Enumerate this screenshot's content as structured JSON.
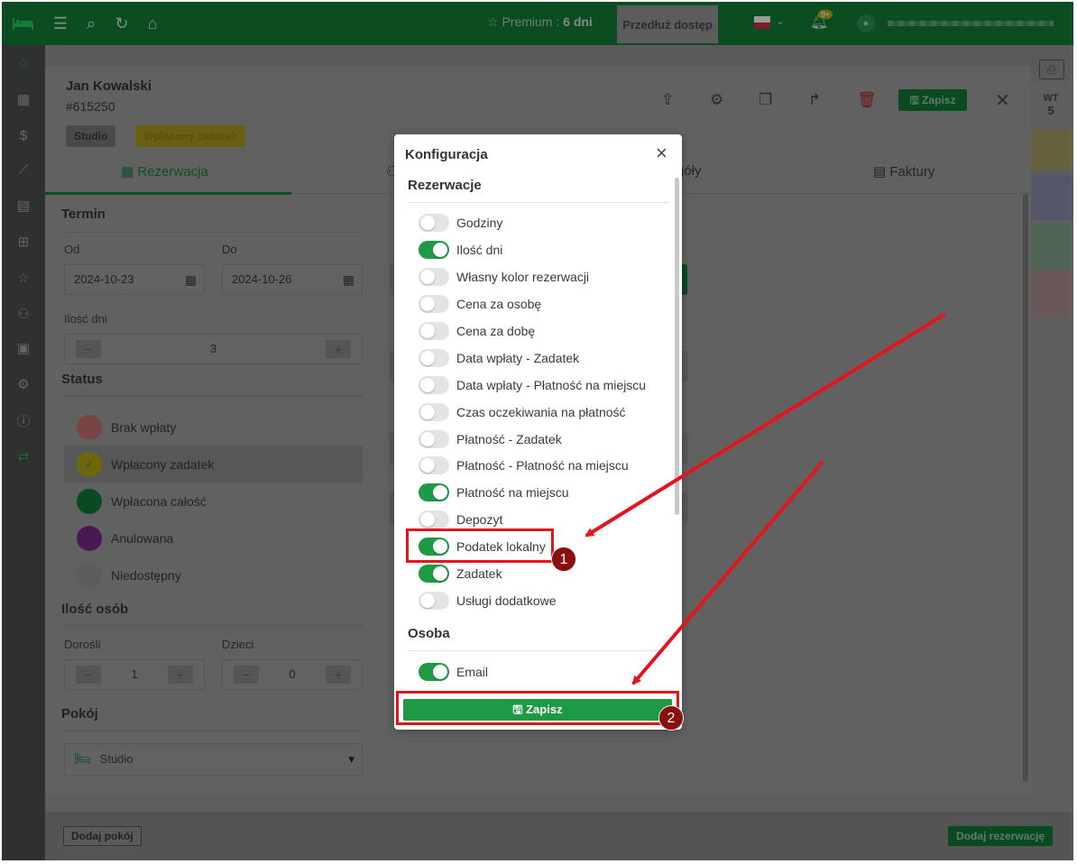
{
  "topbar": {
    "premium_prefix": "Premium : ",
    "premium_days": "6 dni",
    "extend_label": "Przedłuż dostęp",
    "notifications": "9+"
  },
  "background": {
    "add_room": "Dodaj pokój",
    "add_reservation": "Dodaj rezerwację",
    "wt_day": "WT",
    "wt_num": "5"
  },
  "reservation": {
    "guest_name": "Jan Kowalski",
    "number": "#615250",
    "badge_room": "Studio",
    "badge_status": "Wpłacony zadatek",
    "save_label": "Zapisz",
    "tabs": [
      "Rezerwacja",
      "góły",
      "Faktury"
    ],
    "termin": {
      "title": "Termin",
      "from_label": "Od",
      "from_value": "2024-10-23",
      "to_label": "Do",
      "to_value": "2024-10-26",
      "days_label": "Ilość dni",
      "days_value": "3"
    },
    "status": {
      "title": "Status",
      "items": [
        {
          "label": "Brak wpłaty",
          "color": "#7a4444"
        },
        {
          "label": "Wpłacony zadatek",
          "color": "#6d660a"
        },
        {
          "label": "Wpłacona całość",
          "color": "#0a4a22"
        },
        {
          "label": "Anulowana",
          "color": "#4a1852"
        },
        {
          "label": "Niedostępny",
          "color": "#5c5c5c"
        }
      ]
    },
    "persons": {
      "title": "Ilość osób",
      "adults_label": "Dorośli",
      "adults_value": "1",
      "children_label": "Dzieci",
      "children_value": "0"
    },
    "room": {
      "title": "Pokój",
      "value": "Studio"
    }
  },
  "config": {
    "title": "Konfiguracja",
    "section_reservations": "Rezerwacje",
    "reservation_toggles": [
      {
        "label": "Godziny",
        "on": false
      },
      {
        "label": "Ilość dni",
        "on": true
      },
      {
        "label": "Własny kolor rezerwacji",
        "on": false
      },
      {
        "label": "Cena za osobę",
        "on": false
      },
      {
        "label": "Cena za dobę",
        "on": false
      },
      {
        "label": "Data wpłaty - Zadatek",
        "on": false
      },
      {
        "label": "Data wpłaty - Płatność na miejscu",
        "on": false
      },
      {
        "label": "Czas oczekiwania na płatność",
        "on": false
      },
      {
        "label": "Płatność - Zadatek",
        "on": false
      },
      {
        "label": "Płatność - Płatność na miejscu",
        "on": false
      },
      {
        "label": "Płatność na miejscu",
        "on": true
      },
      {
        "label": "Depozyt",
        "on": false
      },
      {
        "label": "Podatek lokalny",
        "on": true
      },
      {
        "label": "Zadatek",
        "on": true
      },
      {
        "label": "Usługi dodatkowe",
        "on": false
      }
    ],
    "section_person": "Osoba",
    "person_toggles": [
      {
        "label": "Email",
        "on": true
      }
    ],
    "save_label": "Zapisz"
  },
  "annotations": [
    "1",
    "2"
  ],
  "colors": {
    "accent_green": "#1f9a44",
    "annotation_red": "#e3141b"
  }
}
